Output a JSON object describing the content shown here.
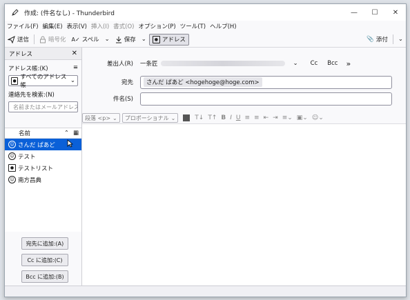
{
  "window": {
    "title": "作成: (件名なし) - Thunderbird"
  },
  "menubar": {
    "items": [
      {
        "label": "ファイル(F)"
      },
      {
        "label": "編集(E)"
      },
      {
        "label": "表示(V)"
      },
      {
        "label": "挿入(I)"
      },
      {
        "label": "書式(O)"
      },
      {
        "label": "オプション(P)"
      },
      {
        "label": "ツール(T)"
      },
      {
        "label": "ヘルプ(H)"
      }
    ]
  },
  "toolbar": {
    "send": "送信",
    "encrypt": "暗号化",
    "spell": "スペル",
    "save": "保存",
    "address": "アドレス",
    "attach": "添付"
  },
  "sidebar": {
    "title": "アドレス",
    "addressbook_label": "アドレス帳:(K)",
    "addressbook_value": "すべてのアドレス帳",
    "search_label": "連絡先を検索:(N)",
    "search_placeholder": "名前またはメールアドレス",
    "column_name": "名前",
    "contacts": [
      {
        "name": "さんだ ぱあど",
        "type": "person"
      },
      {
        "name": "テスト",
        "type": "person"
      },
      {
        "name": "テストリスト",
        "type": "list"
      },
      {
        "name": "南方昌典",
        "type": "person"
      }
    ],
    "actions": {
      "to": "宛先に追加:(A)",
      "cc": "Cc に追加:(C)",
      "bcc": "Bcc に追加:(B)"
    }
  },
  "compose": {
    "from_label": "差出人(R)",
    "from_name": "一条匠",
    "cc": "Cc",
    "bcc": "Bcc",
    "more": "»",
    "to_label": "宛先",
    "to_recipient": "さんだ ぱあど <hogehoge@hoge.com>",
    "subject_label": "件名(S)",
    "subject_value": ""
  },
  "format": {
    "paragraph": "段落 <p>",
    "font": "プロポーショナル"
  }
}
